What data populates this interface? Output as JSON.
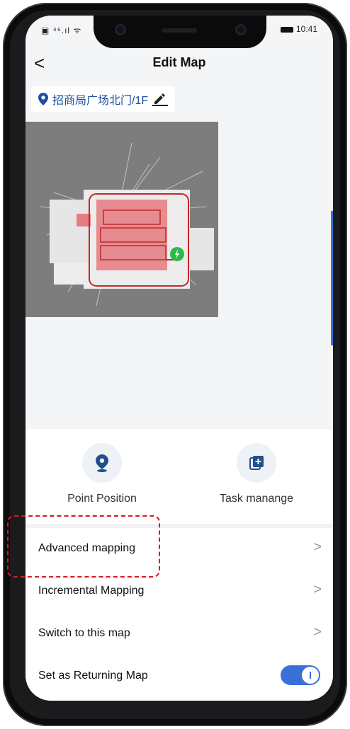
{
  "status": {
    "left_icons": "▣ ⁴⁶.ıl ᯤ",
    "time": "10:41"
  },
  "header": {
    "back_label": "<",
    "title": "Edit Map"
  },
  "location": {
    "text": "招商局广场北门/1F",
    "icon": "pin-icon",
    "edit_icon": "pencil-icon"
  },
  "actions": [
    {
      "label": "Point Position",
      "icon": "point-position-icon"
    },
    {
      "label": "Task manange",
      "icon": "task-add-icon"
    }
  ],
  "menu": [
    {
      "label": "Advanced mapping",
      "chevron": ">"
    },
    {
      "label": "Incremental Mapping",
      "chevron": ">"
    },
    {
      "label": "Switch to this map",
      "chevron": ">"
    },
    {
      "label": "Set as Returning Map",
      "toggle": true
    }
  ],
  "colors": {
    "accent": "#3b6fd8",
    "highlight": "#e0161e",
    "map_bg": "#7d7d7d",
    "charger": "#2db94a"
  }
}
